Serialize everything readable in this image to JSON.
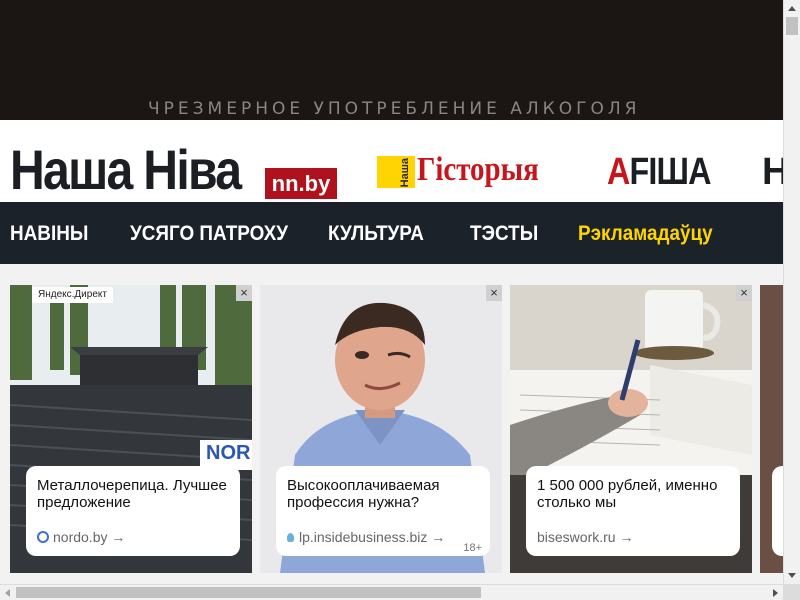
{
  "banner": {
    "warning_text": "ЧРЕЗМЕРНОЕ УПОТРЕБЛЕНИЕ АЛКОГОЛЯ"
  },
  "header": {
    "logo_text": "Наша Ніва",
    "logo_domain": "nn.by",
    "history_small": "Наша",
    "history_text": "Гісторыя",
    "afisha_first": "A",
    "afisha_rest": "FІША",
    "cut_logo": "Н"
  },
  "nav": {
    "items": [
      {
        "label": "НАВІНЫ"
      },
      {
        "label": "УСЯГО ПАТРОХУ"
      },
      {
        "label": "КУЛЬТУРА"
      },
      {
        "label": "ТЭСТЫ"
      },
      {
        "label": "Рэкламадаўцу"
      }
    ]
  },
  "ads": {
    "provider_label": "Яндекс.Директ",
    "close_glyph": "×",
    "cards": [
      {
        "title": "Металлочерепица. Лучшее предложение",
        "domain": "nordo.by →",
        "overlay_text": "NOR"
      },
      {
        "title": "Высокооплачиваемая профессия нужна?",
        "domain": "lp.insidebusiness.biz →",
        "age": "18+"
      },
      {
        "title": "1 500 000 рублей, именно столько мы",
        "domain": "biseswork.ru →"
      }
    ]
  },
  "colors": {
    "brand_red": "#c8151b",
    "accent_yellow": "#ffd400",
    "nav_bg": "#1b2229",
    "banner_bg": "#1b1614"
  }
}
